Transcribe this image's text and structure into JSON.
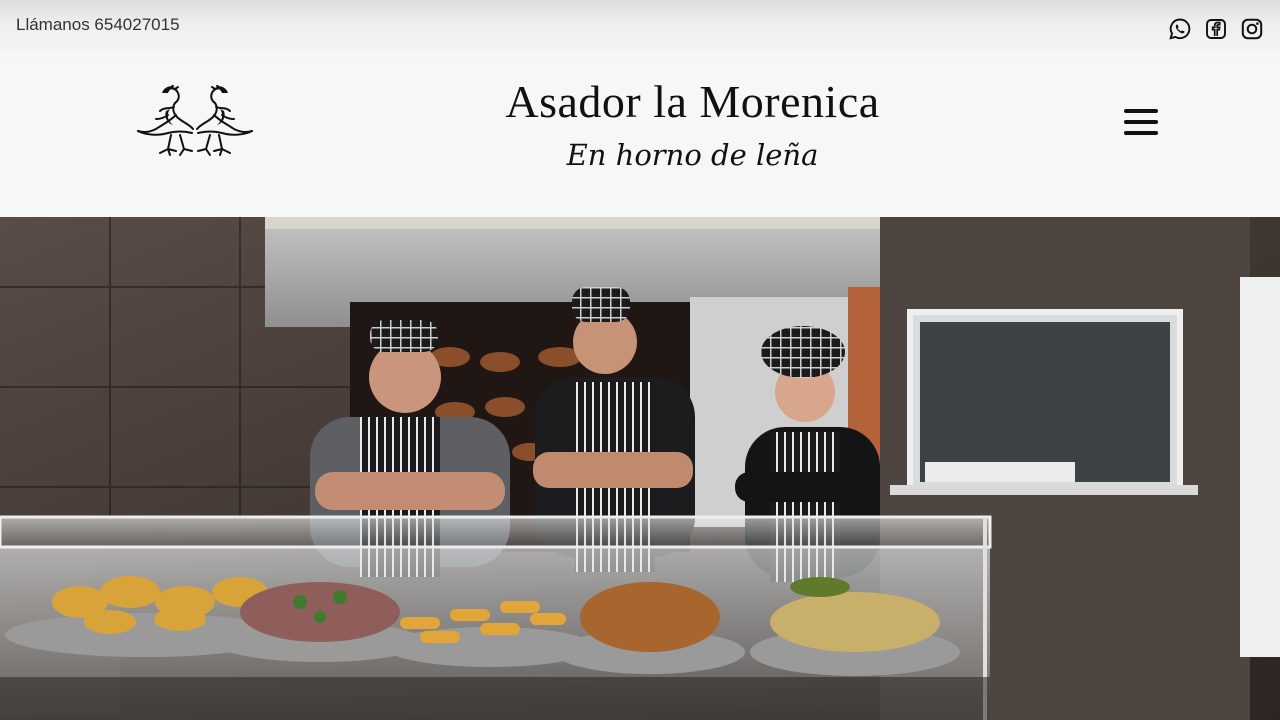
{
  "topbar": {
    "phone_text": "Llámanos 654027015",
    "social": [
      "whatsapp-icon",
      "facebook-icon",
      "instagram-icon"
    ]
  },
  "header": {
    "title": "Asador la Morenica",
    "tagline": "En horno de leña",
    "logo": "roosters-logo",
    "menu_icon": "hamburger-menu-icon"
  },
  "hero": {
    "image": "staff photo behind counter with rotisserie chickens and food trays"
  },
  "colors": {
    "page_bg": "#f6f7f9",
    "text": "#111111"
  }
}
